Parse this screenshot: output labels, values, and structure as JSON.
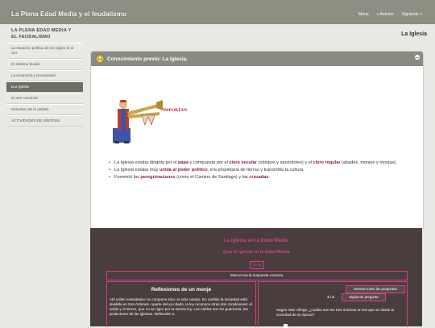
{
  "header": {
    "site_title": "La Plena Edad Media y el feudalismo",
    "nav": [
      "Menú",
      "« Anterior",
      "Siguiente »"
    ]
  },
  "sidebar": {
    "heading": "La Plena Edad Media y el feudalismo",
    "items": [
      {
        "label": "La situación política de los siglos XI al XIII",
        "active": false
      },
      {
        "label": "El sistema feudal",
        "active": false
      },
      {
        "label": "La economía y la sociedad",
        "active": false
      },
      {
        "label": "La Iglesia",
        "active": true
      },
      {
        "label": "El arte románico",
        "active": false
      },
      {
        "label": "Resumen de la unidad.",
        "active": false
      },
      {
        "label": "ACTIVIDADES DE SÍNTESIS",
        "active": false
      }
    ]
  },
  "main": {
    "page_title": "La Iglesia",
    "idevice": {
      "title": "Conocimiento previo: La Iglesia.",
      "illustration_text": "IMPORTAN",
      "bullets": [
        [
          "La Iglesia estaba dirigida por el ",
          {
            "kw": "papa"
          },
          " y compuesta por el ",
          {
            "kw": "clero secular"
          },
          " (obispos y sacerdotes) y el ",
          {
            "kw": "clero regular"
          },
          " (abades, monjes y monjas)."
        ],
        [
          "La Iglesia estaba muy ",
          {
            "kw": "unida al poder político"
          },
          ", era propietaria de tierras y transmitía la cultura."
        ],
        [
          "Fomentó las ",
          {
            "kw": "peregrinaciones"
          },
          " (como el Camino de Santiago) y las ",
          {
            "kw": "cruzadas"
          },
          "."
        ]
      ]
    },
    "quiz": {
      "title": "La iglesia en la Edad Media",
      "subtitle": "Quiz la iglesia en la Edad Media",
      "timer": "00:00",
      "instructions": "Selecciona la respuesta correcta.",
      "reflection_title": "Reflexiones de un monje",
      "reflection_text": "»El orden eclesiástico no compone sino un solo cuerpo. En cambio la sociedad está dividida en tres órdenes. Aparte del ya citado, la ley reconoce otras dos condiciones: el noble y el siervo, que no se rigen por la misma ley. Los nobles son los guerreros, los protectores de las iglesias. Defienden a",
      "show_all_button": "Mostrar todas las preguntas",
      "counter": "1 / 4",
      "next_button": "Siguiente pregunta",
      "question": "Según este clérigo, ¿cuáles son los tres órdenes en los que se divide la sociedad de su época?"
    }
  },
  "colors": {
    "topbar": "#8e8f82",
    "sidebar_active": "#6d6e64",
    "keyword": "#8b1a4a",
    "quiz_background": "#4a3d3e",
    "quiz_accent": "#d0408a"
  }
}
